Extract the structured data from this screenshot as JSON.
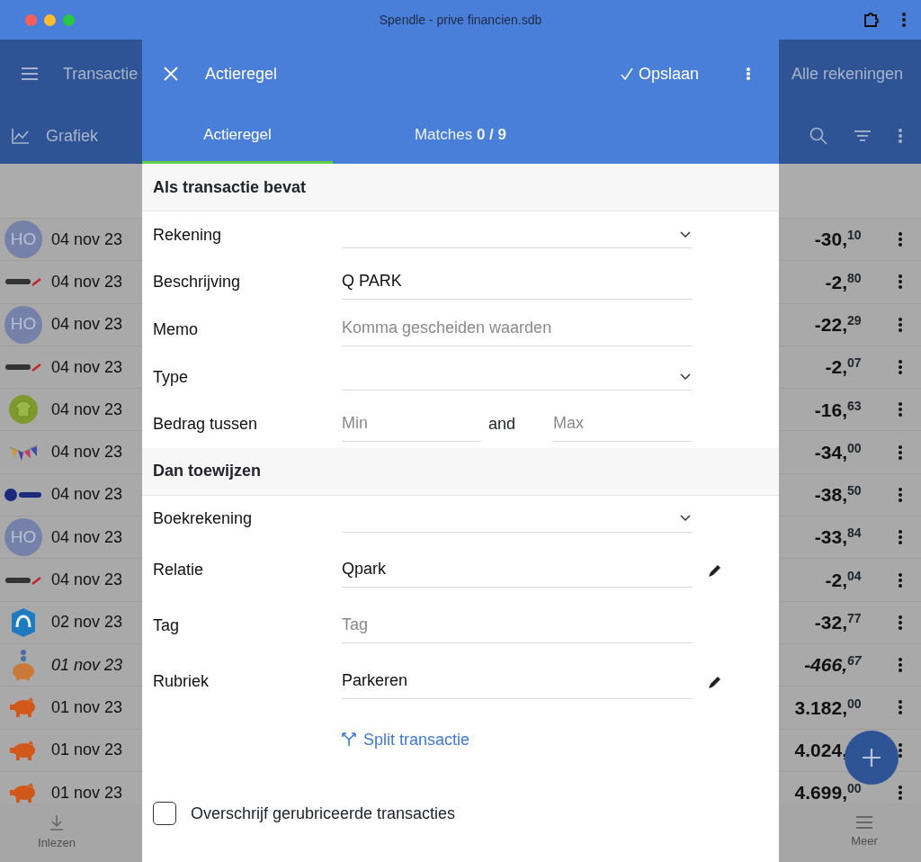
{
  "window": {
    "title": "Spendle - prive financien.sdb"
  },
  "app_bar": {
    "title": "Transactie",
    "accounts": "Alle rekeningen",
    "chart_button": "Grafiek"
  },
  "transactions": [
    {
      "kind": "initials",
      "initials": "HO",
      "date": "04 nov 23",
      "amount": "-30,",
      "cents": "10",
      "planned": false
    },
    {
      "kind": "qpark",
      "date": "04 nov 23",
      "amount": "-2,",
      "cents": "80",
      "planned": false
    },
    {
      "kind": "initials",
      "initials": "HO",
      "date": "04 nov 23",
      "amount": "-22,",
      "cents": "29",
      "planned": false
    },
    {
      "kind": "qpark",
      "date": "04 nov 23",
      "amount": "-2,",
      "cents": "07",
      "planned": false
    },
    {
      "kind": "shirt",
      "date": "04 nov 23",
      "amount": "-16,",
      "cents": "63",
      "planned": false
    },
    {
      "kind": "bunting",
      "date": "04 nov 23",
      "amount": "-34,",
      "cents": "00",
      "planned": false
    },
    {
      "kind": "etos",
      "date": "04 nov 23",
      "amount": "-38,",
      "cents": "50",
      "planned": false
    },
    {
      "kind": "initials",
      "initials": "HO",
      "date": "04 nov 23",
      "amount": "-33,",
      "cents": "84",
      "planned": false
    },
    {
      "kind": "qpark",
      "date": "04 nov 23",
      "amount": "-2,",
      "cents": "04",
      "planned": false
    },
    {
      "kind": "ah",
      "date": "02 nov 23",
      "amount": "-32,",
      "cents": "77",
      "planned": false
    },
    {
      "kind": "piggybank",
      "date": "01 nov 23",
      "amount": "-466,",
      "cents": "67",
      "planned": true
    },
    {
      "kind": "pig",
      "date": "01 nov 23",
      "amount": "3.182,",
      "cents": "00",
      "planned": false
    },
    {
      "kind": "pig",
      "date": "01 nov 23",
      "amount": "4.024,",
      "planned": false
    },
    {
      "kind": "pig",
      "date": "01 nov 23",
      "amount": "4.699,",
      "cents": "00",
      "planned": false
    }
  ],
  "bottom_nav": [
    {
      "label": "Inlezen"
    },
    {
      "label": "Meer"
    }
  ],
  "dialog": {
    "title": "Actieregel",
    "save": "Opslaan",
    "tabs": [
      {
        "label": "Actieregel",
        "selected": true
      },
      {
        "label": "Matches **0 / 9**",
        "selected": false
      }
    ],
    "sections": [
      {
        "title": "Als transactie bevat",
        "fields": [
          {
            "kind": "select",
            "label": "Rekening"
          },
          {
            "kind": "text",
            "label": "Beschrijving",
            "value": "Q PARK",
            "editable": false
          },
          {
            "kind": "text",
            "label": "Memo",
            "placeholder": "Komma gescheiden waarden",
            "editable": false
          },
          {
            "kind": "select",
            "label": "Type"
          },
          {
            "kind": "range",
            "label": "Bedrag tussen",
            "min_placeholder": "Min",
            "joiner": "and",
            "max_placeholder": "Max"
          }
        ]
      },
      {
        "title": "Dan toewijzen",
        "fields": [
          {
            "kind": "select",
            "label": "Boekrekening"
          },
          {
            "kind": "text",
            "label": "Relatie",
            "value": "Qpark",
            "editable": true
          },
          {
            "kind": "text",
            "label": "Tag",
            "placeholder": "Tag",
            "editable": false
          },
          {
            "kind": "text",
            "label": "Rubriek",
            "value": "Parkeren",
            "editable": true
          }
        ]
      }
    ],
    "split": "Split transactie",
    "overwrite": {
      "label": "Overschrijf gerubriceerde transacties",
      "checked": false
    }
  }
}
